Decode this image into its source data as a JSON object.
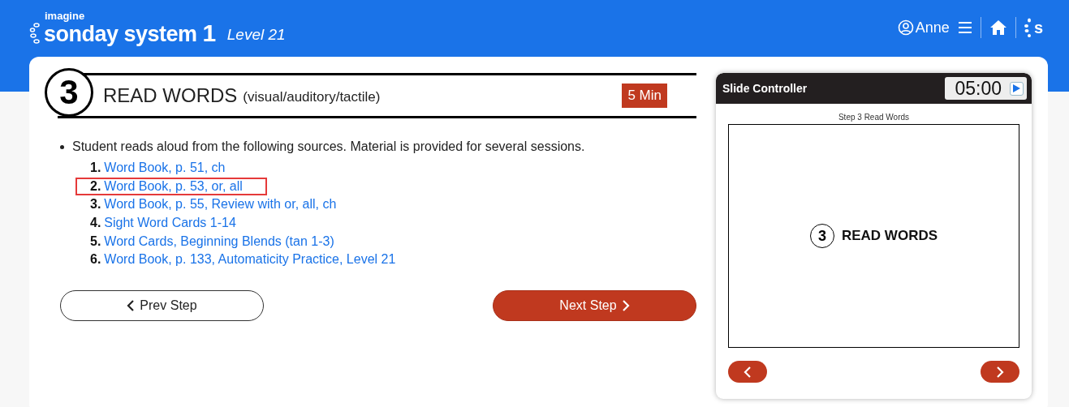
{
  "header": {
    "brand_top": "imagine",
    "brand": "sonday system",
    "brand_number": "1",
    "level": "Level 21",
    "user": "Anne",
    "logo_mark": "s"
  },
  "step": {
    "number": "3",
    "title": "READ WORDS",
    "subtitle": "(visual/auditory/tactile)",
    "duration": "5 Min",
    "instruction": "Student reads aloud from the following sources. Material is provided for several sessions.",
    "sources": [
      {
        "number": "1.",
        "label": "Word Book, p. 51, ch",
        "highlighted": false
      },
      {
        "number": "2.",
        "label": "Word Book, p. 53, or, all",
        "highlighted": true
      },
      {
        "number": "3.",
        "label": "Word Book, p. 55, Review with or, all, ch",
        "highlighted": false
      },
      {
        "number": "4.",
        "label": "Sight Word Cards 1-14",
        "highlighted": false
      },
      {
        "number": "5.",
        "label": "Word Cards, Beginning Blends (tan 1-3)",
        "highlighted": false
      },
      {
        "number": "6.",
        "label": "Word Book, p. 133, Automaticity Practice, Level 21",
        "highlighted": false
      }
    ],
    "prev_button": "Prev Step",
    "next_button": "Next Step"
  },
  "slide_controller": {
    "title": "Slide Controller",
    "timer": "05:00",
    "slide_caption": "Step 3 Read Words",
    "slide_number": "3",
    "slide_title": "READ WORDS"
  }
}
